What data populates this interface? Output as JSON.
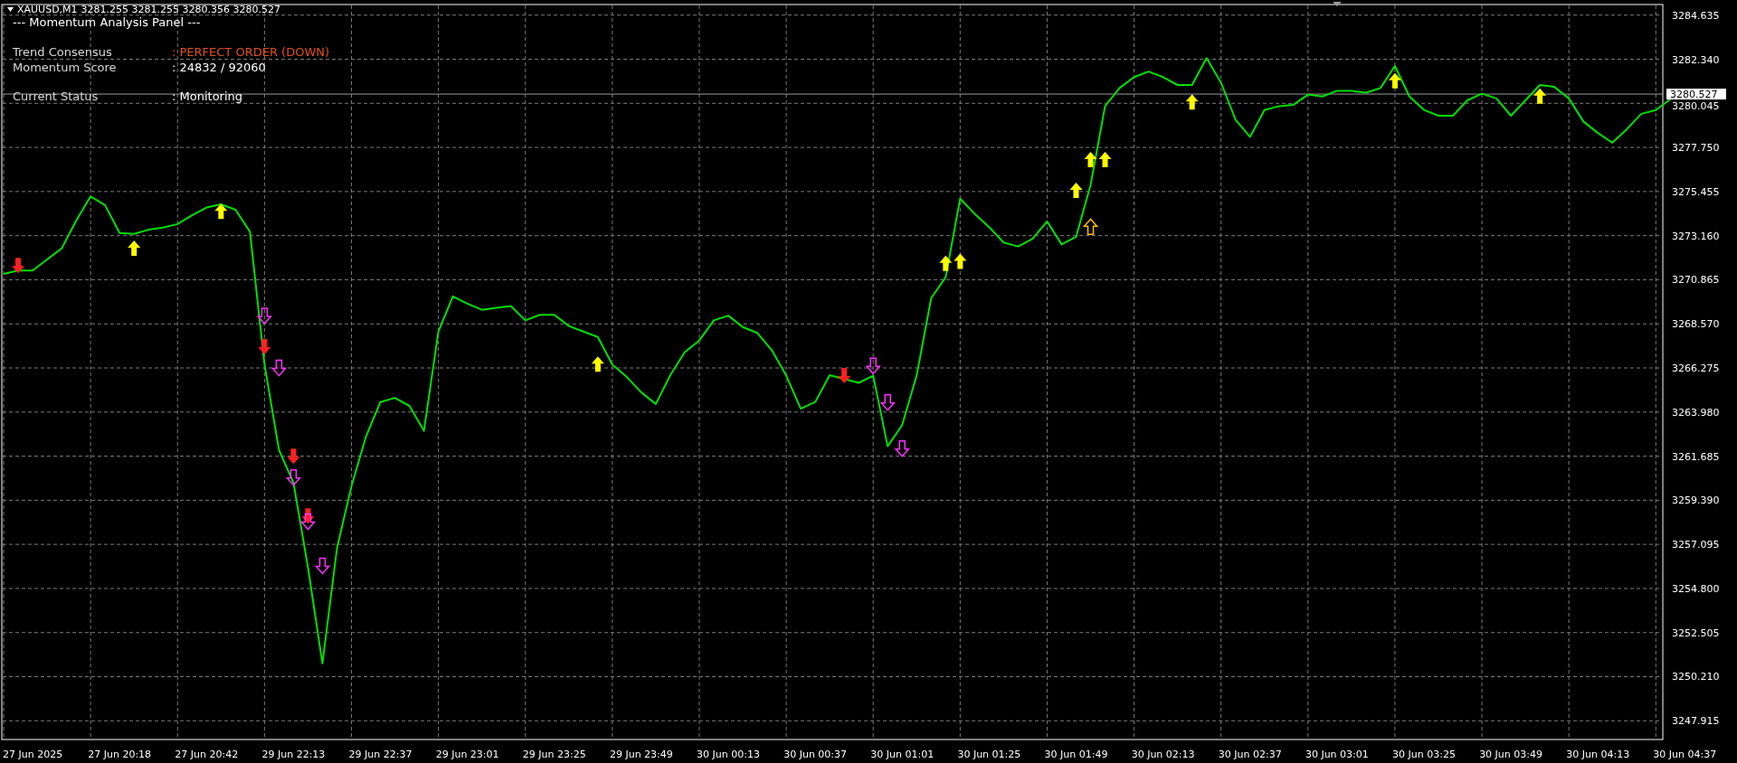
{
  "header": {
    "quote": "3281.255 3281.255 3280.356 3280.527"
  },
  "panel": {
    "title": "--- Momentum Analysis Panel ---",
    "rows": [
      {
        "label": "Trend Consensus",
        "value": ": PERFECT ORDER (DOWN)",
        "color": "#e0501a"
      },
      {
        "label": "Momentum Score",
        "value": ": 24832 / 92060",
        "color": "#ffffff"
      },
      {
        "label": "Current Status",
        "value": ": Monitoring",
        "color": "#ffffff"
      }
    ]
  },
  "chart_data": {
    "type": "line",
    "ylim": [
      3246.94,
      3285.14
    ],
    "grid": true,
    "ref_lines": [
      {
        "axis": "y",
        "value": 3280.527,
        "label": "3280.527"
      }
    ],
    "categories": [
      null,
      null,
      "27 Jun 2025",
      null,
      null,
      null,
      null,
      null,
      "27 Jun 20:18",
      null,
      null,
      null,
      null,
      null,
      "27 Jun 20:42",
      null,
      null,
      null,
      null,
      null,
      "29 Jun 22:13",
      null,
      null,
      null,
      null,
      null,
      "29 Jun 22:37",
      null,
      null,
      null,
      null,
      null,
      "29 Jun 23:01",
      null,
      null,
      null,
      null,
      null,
      "29 Jun 23:25",
      null,
      null,
      null,
      null,
      null,
      "29 Jun 23:49",
      null,
      null,
      null,
      null,
      null,
      "30 Jun 00:13",
      null,
      null,
      null,
      null,
      null,
      "30 Jun 00:37",
      null,
      null,
      null,
      null,
      null,
      "30 Jun 01:01",
      null,
      null,
      null,
      null,
      null,
      "30 Jun 01:25",
      null,
      null,
      null,
      null,
      null,
      "30 Jun 01:49",
      null,
      null,
      null,
      null,
      null,
      "30 Jun 02:13",
      null,
      null,
      null,
      null,
      null,
      "30 Jun 02:37",
      null,
      null,
      null,
      null,
      null,
      "30 Jun 03:01",
      null,
      null,
      null,
      null,
      null,
      "30 Jun 03:25",
      null,
      null,
      null,
      null,
      null,
      "30 Jun 03:49",
      null,
      null,
      null,
      null,
      null,
      "30 Jun 04:13",
      null,
      null,
      null,
      null,
      null,
      "30 Jun 04:37"
    ],
    "series": [
      {
        "name": "XAUUSD,M1",
        "color": "#00e000",
        "values": [
          3271.17,
          3271.34,
          3271.34,
          3271.92,
          3272.49,
          3273.93,
          3275.2,
          3274.75,
          3273.3,
          3273.25,
          3273.47,
          3273.58,
          3273.76,
          3274.22,
          3274.62,
          3274.79,
          3274.51,
          3273.36,
          3266.45,
          3262.0,
          3260.3,
          3255.9,
          3250.9,
          3256.9,
          3260.12,
          3262.7,
          3264.5,
          3264.72,
          3264.3,
          3263.0,
          3268.17,
          3270.0,
          3269.62,
          3269.3,
          3269.4,
          3269.5,
          3268.75,
          3269.04,
          3269.04,
          3268.46,
          3268.17,
          3267.89,
          3266.45,
          3265.8,
          3265.0,
          3264.4,
          3265.9,
          3267.1,
          3267.7,
          3268.75,
          3269.0,
          3268.4,
          3268.1,
          3267.2,
          3265.87,
          3264.15,
          3264.5,
          3265.9,
          3265.7,
          3265.5,
          3265.87,
          3262.2,
          3263.3,
          3265.9,
          3269.91,
          3271.0,
          3275.08,
          3274.3,
          3273.6,
          3272.8,
          3272.6,
          3273.0,
          3273.9,
          3272.7,
          3273.1,
          3275.8,
          3279.9,
          3280.84,
          3281.41,
          3281.7,
          3281.41,
          3281.0,
          3281.0,
          3282.4,
          3281.12,
          3279.2,
          3278.3,
          3279.69,
          3279.9,
          3279.97,
          3280.5,
          3280.4,
          3280.7,
          3280.7,
          3280.6,
          3280.84,
          3281.99,
          3280.4,
          3279.7,
          3279.4,
          3279.4,
          3280.2,
          3280.55,
          3280.3,
          3279.4,
          3280.2,
          3281.0,
          3280.9,
          3280.3,
          3279.1,
          3278.5,
          3278.0,
          3278.7,
          3279.5,
          3279.69,
          3280.26,
          null
        ]
      },
      {
        "type": "scatter",
        "color": "#ff2020",
        "values": [
          null,
          3271.63,
          null,
          null,
          null,
          null,
          null,
          null,
          null,
          null,
          null,
          null,
          null,
          null,
          null,
          null,
          null,
          null,
          3267.4,
          null,
          3261.7,
          3258.6,
          null,
          null,
          null,
          null,
          null,
          null,
          null,
          null,
          null,
          null,
          null,
          null,
          null,
          null,
          null,
          null,
          null,
          null,
          null,
          null,
          null,
          null,
          null,
          null,
          null,
          null,
          null,
          null,
          null,
          null,
          null,
          null,
          null,
          null,
          null,
          null,
          3265.9,
          null,
          null,
          null,
          null,
          null,
          null,
          null,
          null,
          null,
          null,
          null,
          null,
          null,
          null,
          null,
          null,
          null,
          null,
          null,
          null,
          null,
          null,
          null,
          null,
          null,
          null,
          null,
          null,
          null,
          null,
          null,
          null,
          null,
          null,
          null,
          null,
          null,
          null,
          null,
          null,
          null,
          null,
          null,
          null,
          null,
          null,
          null,
          null,
          null,
          null,
          null,
          null,
          null,
          null,
          null,
          null,
          null,
          null
        ]
      },
      {
        "type": "scatter",
        "color": "#ff30ff",
        "values": [
          null,
          null,
          null,
          null,
          null,
          null,
          null,
          null,
          null,
          null,
          null,
          null,
          null,
          null,
          null,
          null,
          null,
          null,
          3269.0,
          3266.3,
          3260.6,
          3258.3,
          3256.0,
          null,
          null,
          null,
          null,
          null,
          null,
          null,
          null,
          null,
          null,
          null,
          null,
          null,
          null,
          null,
          null,
          null,
          null,
          null,
          null,
          null,
          null,
          null,
          null,
          null,
          null,
          null,
          null,
          null,
          null,
          null,
          null,
          null,
          null,
          null,
          null,
          null,
          3266.4,
          3264.5,
          3262.1,
          null,
          null,
          null,
          null,
          null,
          null,
          null,
          null,
          null,
          null,
          null,
          null,
          null,
          null,
          null,
          null,
          null,
          null,
          null,
          null,
          null,
          null,
          null,
          null,
          null,
          null,
          null,
          null,
          null,
          null,
          null,
          null,
          null,
          null,
          null,
          null,
          null,
          null,
          null,
          null,
          null,
          null,
          null,
          null,
          null,
          null,
          null,
          null,
          null,
          null,
          null,
          null,
          null,
          null
        ]
      },
      {
        "type": "scatter",
        "color": "#ffff00",
        "values": [
          null,
          null,
          null,
          null,
          null,
          null,
          null,
          null,
          null,
          3272.49,
          null,
          null,
          null,
          null,
          null,
          3274.4,
          null,
          null,
          null,
          null,
          null,
          null,
          null,
          null,
          null,
          null,
          null,
          null,
          null,
          null,
          null,
          null,
          null,
          null,
          null,
          null,
          null,
          null,
          null,
          null,
          null,
          3266.45,
          null,
          null,
          null,
          null,
          null,
          null,
          null,
          null,
          null,
          null,
          null,
          null,
          null,
          null,
          null,
          null,
          null,
          null,
          null,
          null,
          null,
          null,
          null,
          3271.7,
          3271.8,
          null,
          null,
          null,
          null,
          null,
          null,
          null,
          3275.5,
          3277.1,
          3277.1,
          null,
          null,
          null,
          null,
          null,
          3280.1,
          null,
          null,
          null,
          null,
          null,
          null,
          null,
          null,
          null,
          null,
          null,
          null,
          null,
          3281.2,
          null,
          null,
          null,
          null,
          null,
          null,
          null,
          null,
          null,
          3280.4,
          null,
          null,
          null,
          null,
          null,
          null,
          null,
          null,
          null,
          null
        ]
      },
      {
        "type": "scatter",
        "color": "#ffc000",
        "values": [
          null,
          null,
          null,
          null,
          null,
          null,
          null,
          null,
          null,
          null,
          null,
          null,
          null,
          null,
          null,
          null,
          null,
          null,
          null,
          null,
          null,
          null,
          null,
          null,
          null,
          null,
          null,
          null,
          null,
          null,
          null,
          null,
          null,
          null,
          null,
          null,
          null,
          null,
          null,
          null,
          null,
          null,
          null,
          null,
          null,
          null,
          null,
          null,
          null,
          null,
          null,
          null,
          null,
          null,
          null,
          null,
          null,
          null,
          null,
          null,
          null,
          null,
          null,
          null,
          null,
          null,
          null,
          null,
          null,
          null,
          null,
          null,
          null,
          null,
          null,
          3273.6,
          null,
          null,
          null,
          null,
          null,
          null,
          null,
          null,
          null,
          null,
          null,
          null,
          null,
          null,
          null,
          null,
          null,
          null,
          null,
          null,
          null,
          null,
          null,
          null,
          null,
          null,
          null,
          null,
          null,
          null,
          null,
          null,
          null,
          null,
          null,
          null,
          null,
          null,
          null,
          null,
          null
        ]
      }
    ],
    "yticks": [
      {
        "value": 3284.635,
        "label": "3284.635"
      },
      {
        "value": 3282.34,
        "label": "3282.340"
      },
      {
        "value": 3280.045,
        "label": "3280.045"
      },
      {
        "value": 3277.75,
        "label": "3277.750"
      },
      {
        "value": 3275.455,
        "label": "3275.455"
      },
      {
        "value": 3273.16,
        "label": "3273.160"
      },
      {
        "value": 3270.865,
        "label": "3270.865"
      },
      {
        "value": 3268.57,
        "label": "3268.570"
      },
      {
        "value": 3266.275,
        "label": "3266.275"
      },
      {
        "value": 3263.98,
        "label": "3263.980"
      },
      {
        "value": 3261.685,
        "label": "3261.685"
      },
      {
        "value": 3259.39,
        "label": "3259.390"
      },
      {
        "value": 3257.095,
        "label": "3257.095"
      },
      {
        "value": 3254.8,
        "label": "3254.800"
      },
      {
        "value": 3252.505,
        "label": "3252.505"
      },
      {
        "value": 3250.21,
        "label": "3250.210"
      },
      {
        "value": 3247.915,
        "label": "3247.915"
      }
    ]
  }
}
